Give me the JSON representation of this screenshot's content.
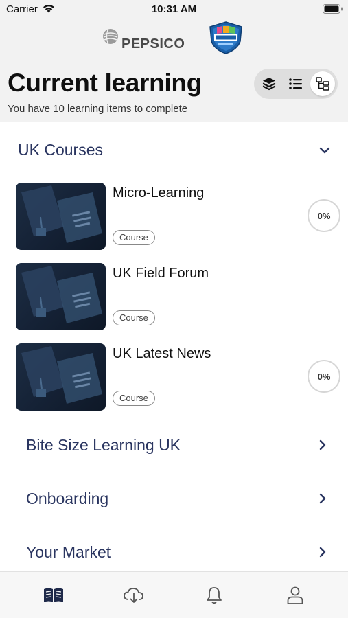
{
  "status_bar": {
    "carrier": "Carrier",
    "time": "10:31 AM"
  },
  "header": {
    "brand": "PEPSICO",
    "title": "Current learning",
    "subtitle": "You have 10 learning items to complete",
    "view_modes": [
      "stack-icon",
      "list-icon",
      "tree-icon"
    ],
    "active_view": "tree"
  },
  "sections": [
    {
      "title": "UK Courses",
      "expanded": true,
      "items": [
        {
          "title": "Micro-Learning",
          "tag": "Course",
          "progress": "0%"
        },
        {
          "title": "UK Field Forum",
          "tag": "Course",
          "progress": null
        },
        {
          "title": "UK Latest News",
          "tag": "Course",
          "progress": "0%"
        }
      ]
    },
    {
      "title": "Bite Size Learning UK",
      "expanded": false
    },
    {
      "title": "Onboarding",
      "expanded": false
    },
    {
      "title": "Your Market",
      "expanded": false
    }
  ],
  "tab_bar": {
    "tabs": [
      "book-icon",
      "cloud-download-icon",
      "bell-icon",
      "profile-icon"
    ],
    "active": "book-icon"
  },
  "colors": {
    "header_bg": "#f2f2f2",
    "section_title": "#2a3560",
    "active_tab": "#1f2a4a"
  }
}
